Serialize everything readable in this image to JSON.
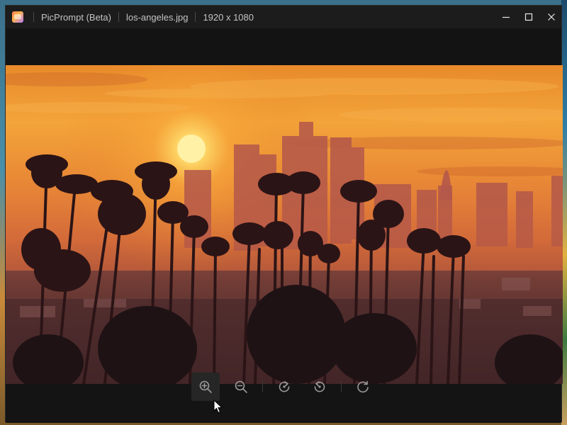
{
  "window": {
    "app_name": "PicPrompt (Beta)",
    "file_name": "los-angeles.jpg",
    "dimensions": "1920 x 1080"
  },
  "controls": {
    "minimize": "minimize-icon",
    "maximize": "maximize-icon",
    "close": "close-icon"
  },
  "toolbar": {
    "buttons": [
      "zoom-in-icon",
      "zoom-out-icon",
      "rotate-right-icon",
      "rotate-left-icon",
      "reset-icon"
    ]
  },
  "image": {
    "alt": "Los Angeles skyline at sunset with palm trees"
  },
  "colors": {
    "titlebar": "#1c1c1c",
    "background": "#141414",
    "sun": "#fff1a6",
    "sky_top": "#e88a2a",
    "silhouette": "#3a1c1e"
  }
}
